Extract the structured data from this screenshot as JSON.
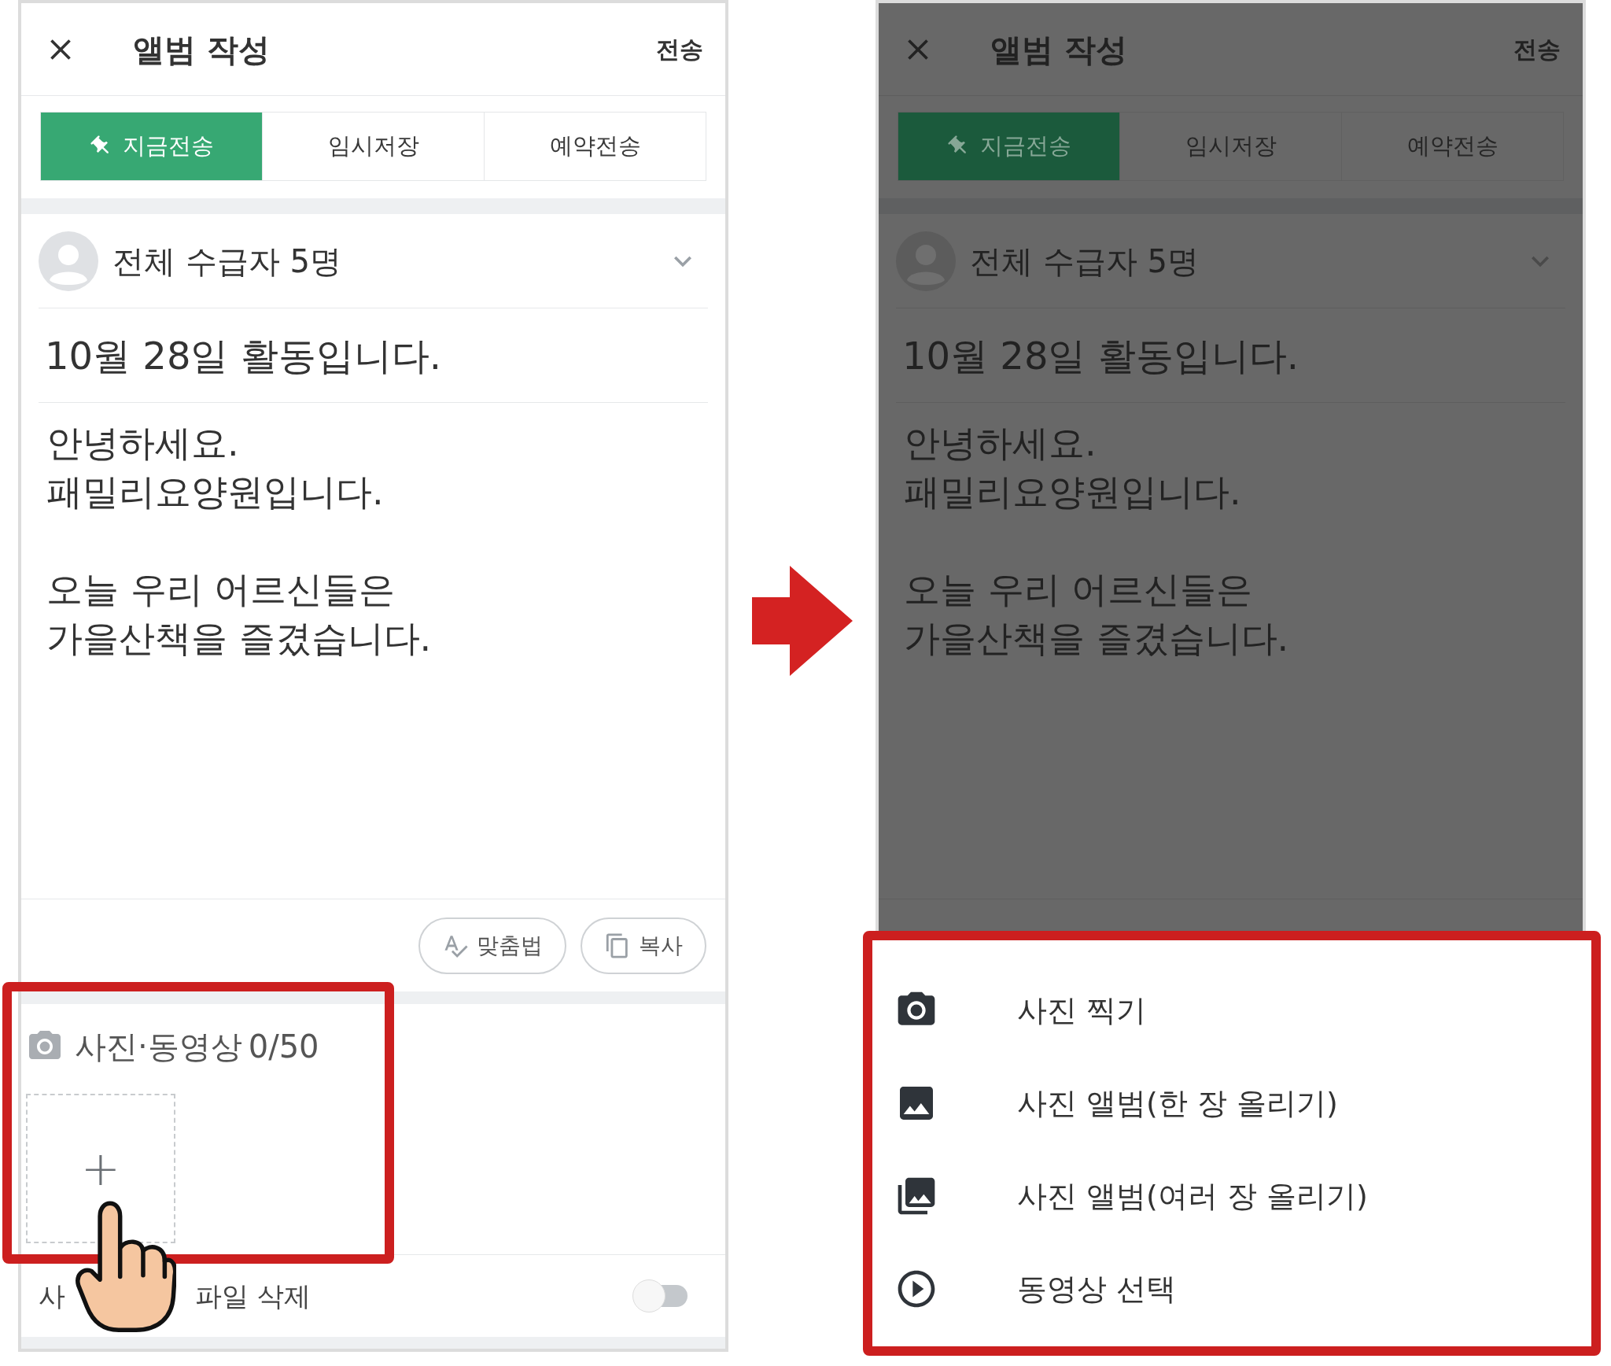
{
  "screens": [
    {
      "dimmed": false,
      "header": {
        "title": "앨범 작성",
        "action": "전송"
      },
      "tabs": [
        {
          "label": "지금전송",
          "selected": true
        },
        {
          "label": "임시저장",
          "selected": false
        },
        {
          "label": "예약전송",
          "selected": false
        }
      ],
      "recipients": "전체 수급자 5명",
      "subject": "10월 28일 활동입니다.",
      "body": [
        [
          "안녕하세요.",
          "패밀리요양원입니다."
        ],
        [
          "오늘 우리 어르신들은",
          "가을산책을 즐겼습니다."
        ]
      ],
      "buttons": [
        {
          "kind": "spellcheck",
          "label": "맞춤법"
        },
        {
          "kind": "copy",
          "label": "복사"
        }
      ],
      "attachments": {
        "label": "사진·동영상",
        "count": "0/50",
        "add": "+"
      },
      "toggle_row": {
        "label_start": "사",
        "label_end": "파일 삭제",
        "on": false
      }
    },
    {
      "dimmed": true,
      "header": {
        "title": "앨범 작성",
        "action": "전송"
      },
      "tabs": [
        {
          "label": "지금전송",
          "selected": true
        },
        {
          "label": "임시저장",
          "selected": false
        },
        {
          "label": "예약전송",
          "selected": false
        }
      ],
      "recipients": "전체 수급자 5명",
      "subject": "10월 28일 활동입니다.",
      "body": [
        [
          "안녕하세요.",
          "패밀리요양원입니다."
        ],
        [
          "오늘 우리 어르신들은",
          "가을산책을 즐겼습니다."
        ]
      ]
    }
  ],
  "sheet": {
    "items": [
      {
        "kind": "camera",
        "label": "사진 찍기"
      },
      {
        "kind": "image",
        "label": "사진 앨범(한 장 올리기)"
      },
      {
        "kind": "images",
        "label": "사진 앨범(여러 장 올리기)"
      },
      {
        "kind": "video",
        "label": "동영상 선택"
      }
    ]
  }
}
